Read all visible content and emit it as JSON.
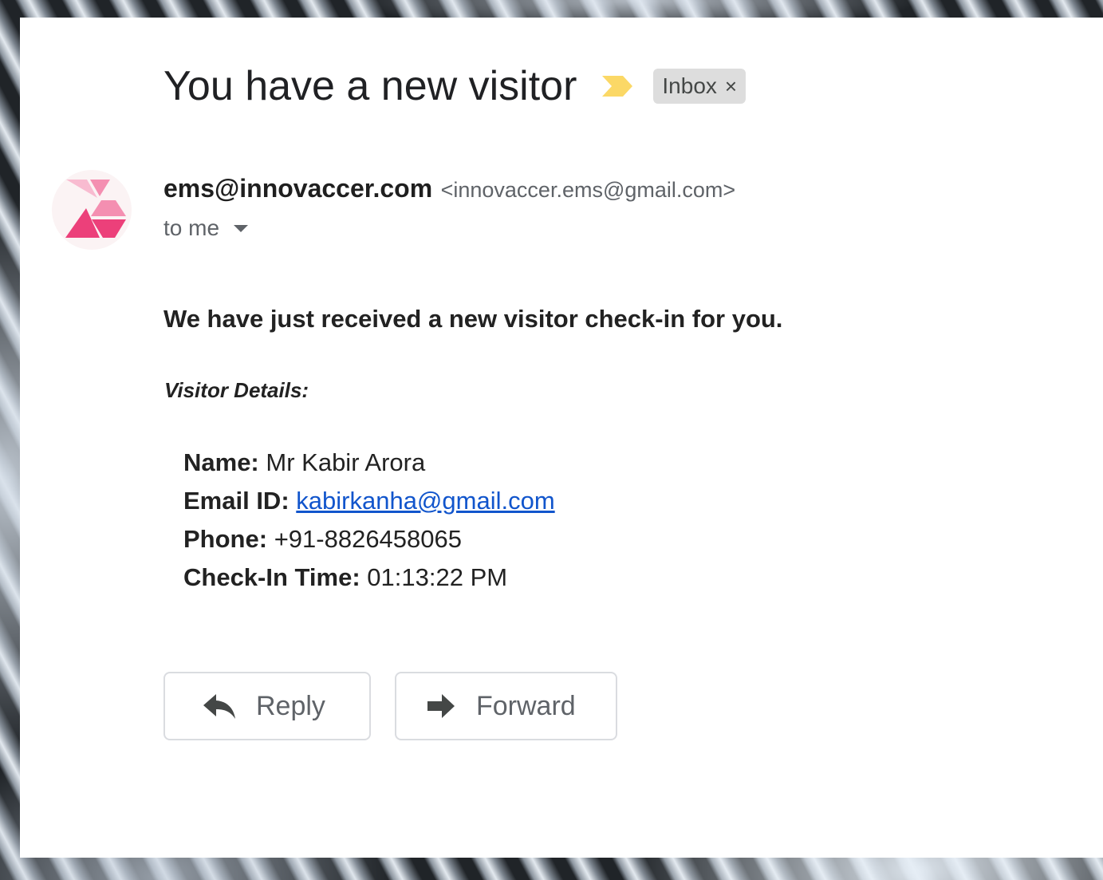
{
  "message": {
    "subject": "You have a new visitor",
    "label_chip": "Inbox",
    "label_remove": "×",
    "sender_name": "ems@innovaccer.com",
    "sender_email": "<innovaccer.ems@gmail.com>",
    "recipient": "to me"
  },
  "body": {
    "intro": "We have just received a new visitor check-in for you.",
    "details_heading": "Visitor Details:",
    "details": [
      {
        "label": "Name:",
        "value": "Mr Kabir Arora"
      },
      {
        "label": "Email ID:",
        "value": "kabirkanha@gmail.com"
      },
      {
        "label": "Phone:",
        "value": "+91-8826458065"
      },
      {
        "label": "Check-In Time:",
        "value": "01:13:22 PM"
      }
    ]
  },
  "actions": {
    "reply_label": "Reply",
    "forward_label": "Forward"
  },
  "colors": {
    "importance_marker": "#fbd866",
    "avatar_light": "#f8bbd0",
    "avatar_mid": "#f48fb1",
    "avatar_dark": "#ec407a",
    "link": "#1155cc"
  },
  "icons": {
    "importance": "importance-marker-icon",
    "remove_label": "close-icon",
    "recipient_details": "chevron-down-icon",
    "reply": "reply-arrow-icon",
    "forward": "forward-arrow-icon"
  }
}
